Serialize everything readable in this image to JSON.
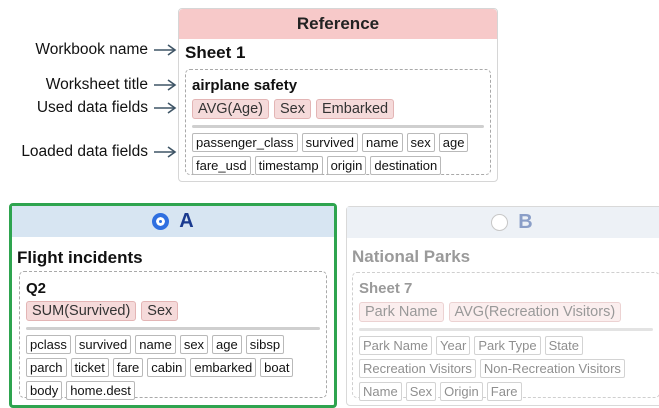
{
  "annotations": {
    "workbook_name": "Workbook name",
    "worksheet_title": "Worksheet title",
    "used_fields": "Used data fields",
    "loaded_fields": "Loaded data fields"
  },
  "reference": {
    "header": "Reference",
    "workbook": "Sheet 1",
    "worksheet": "airplane safety",
    "used": [
      "AVG(Age)",
      "Sex",
      "Embarked"
    ],
    "loaded": [
      "passenger_class",
      "survived",
      "name",
      "sex",
      "age",
      "fare_usd",
      "timestamp",
      "origin",
      "destination"
    ]
  },
  "option_a": {
    "label": "A",
    "selected": true,
    "workbook": "Flight incidents",
    "worksheet": "Q2",
    "used": [
      "SUM(Survived)",
      "Sex"
    ],
    "loaded": [
      "pclass",
      "survived",
      "name",
      "sex",
      "age",
      "sibsp",
      "parch",
      "ticket",
      "fare",
      "cabin",
      "embarked",
      "boat",
      "body",
      "home.dest"
    ]
  },
  "option_b": {
    "label": "B",
    "selected": false,
    "workbook": "National Parks",
    "worksheet": "Sheet 7",
    "used": [
      "Park Name",
      "AVG(Recreation Visitors)"
    ],
    "loaded": [
      "Park Name",
      "Year",
      "Park Type",
      "State",
      "Recreation Visitors",
      "Non-Recreation Visitors",
      "Name",
      "Sex",
      "Origin",
      "Fare"
    ]
  },
  "colors": {
    "reference_header": "#f7c9c9",
    "selected_border": "#2ea44f",
    "radio_selected": "#2f6fe0",
    "used_chip": "#f5dada"
  }
}
